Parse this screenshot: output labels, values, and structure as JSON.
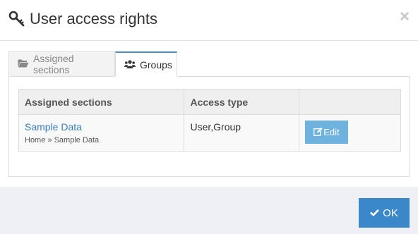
{
  "dialog": {
    "title": "User access rights",
    "close_symbol": "×",
    "title_icon": "key-icon",
    "close_icon": "close-icon"
  },
  "tabs": [
    {
      "label": "Assigned sections",
      "icon": "folder-open-icon",
      "active": false
    },
    {
      "label": "Groups",
      "icon": "users-icon",
      "active": true
    }
  ],
  "table": {
    "headers": [
      "Assigned sections",
      "Access type",
      ""
    ],
    "rows": [
      {
        "section": "Sample Data",
        "breadcrumb": "Home » Sample Data",
        "access_type": "User,Group",
        "action_label": "Edit",
        "action_icon": "edit-icon"
      }
    ]
  },
  "footer": {
    "ok_label": "OK",
    "ok_icon": "check-icon"
  },
  "colors": {
    "accent": "#3a87c9",
    "edit_button": "#6eb3e0",
    "link": "#3a7fc1",
    "active_tab_border": "#4a90c8"
  }
}
